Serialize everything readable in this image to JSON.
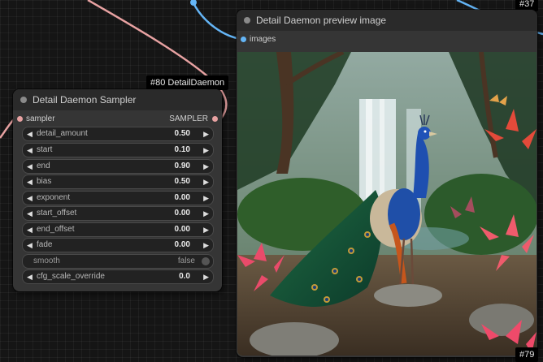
{
  "canvas": {
    "top_right_badge": "#37"
  },
  "sampler_node": {
    "badge": "#80 DetailDaemon",
    "title": "Detail Daemon Sampler",
    "input_label": "sampler",
    "output_label": "SAMPLER",
    "widgets": [
      {
        "name": "detail_amount",
        "value": "0.50"
      },
      {
        "name": "start",
        "value": "0.10"
      },
      {
        "name": "end",
        "value": "0.90"
      },
      {
        "name": "bias",
        "value": "0.50"
      },
      {
        "name": "exponent",
        "value": "0.00"
      },
      {
        "name": "start_offset",
        "value": "0.00"
      },
      {
        "name": "end_offset",
        "value": "0.00"
      },
      {
        "name": "fade",
        "value": "0.00"
      }
    ],
    "toggle": {
      "name": "smooth",
      "value": "false"
    },
    "cfg_widget": {
      "name": "cfg_scale_override",
      "value": "0.0"
    }
  },
  "preview_node": {
    "title": "Detail Daemon preview image",
    "input_label": "images",
    "badge": "#79",
    "image_icon": "peacock-waterfall-image"
  },
  "colors": {
    "canvas_bg": "#151515",
    "node_body": "#353535",
    "node_title_bar": "#2a2a2a",
    "sampler_wire": "#e8a2a2",
    "image_wire": "#64b5f6"
  }
}
